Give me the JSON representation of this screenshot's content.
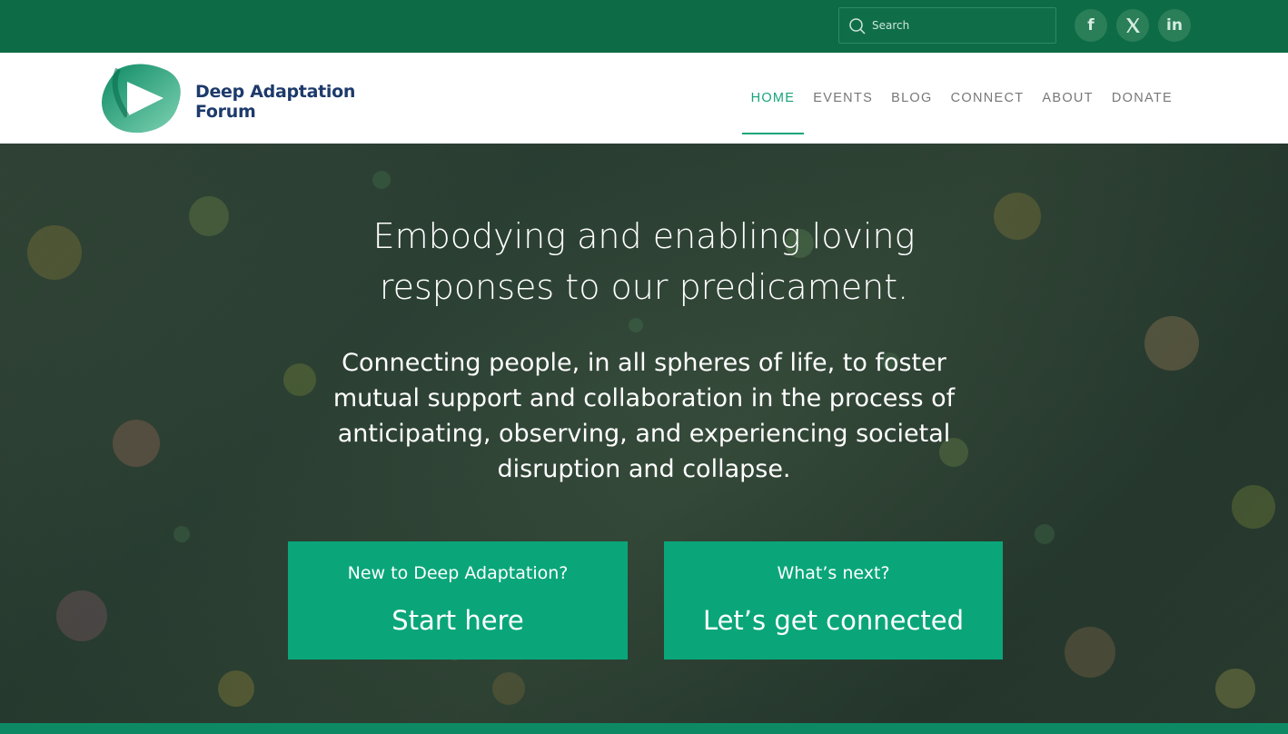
{
  "topbar": {
    "search": {
      "placeholder": "Search"
    },
    "social": [
      {
        "name": "facebook",
        "glyph": "f"
      },
      {
        "name": "x",
        "glyph": "𝕏"
      },
      {
        "name": "linkedin",
        "glyph": "in"
      }
    ]
  },
  "header": {
    "logo": {
      "line1": "Deep Adaptation",
      "line2": "Forum"
    },
    "nav": [
      {
        "label": "HOME",
        "active": true
      },
      {
        "label": "EVENTS"
      },
      {
        "label": "BLOG"
      },
      {
        "label": "CONNECT"
      },
      {
        "label": "ABOUT"
      },
      {
        "label": "DONATE"
      }
    ]
  },
  "hero": {
    "title_line1": "Embodying and enabling loving",
    "title_line2": "responses to our predicament.",
    "subtitle": "Connecting people, in all spheres of life, to foster mutual support and collaboration in the process of anticipating, observing, and experiencing societal disruption and collapse.",
    "cta": [
      {
        "small": "New to Deep Adaptation?",
        "big": "Start here"
      },
      {
        "small": "What’s next?",
        "big": "Let’s get connected"
      }
    ]
  },
  "colors": {
    "topbar": "#0d6b45",
    "accent": "#0aa67a",
    "nav_active": "#17a47a",
    "logo_text": "#1d3a6b"
  }
}
